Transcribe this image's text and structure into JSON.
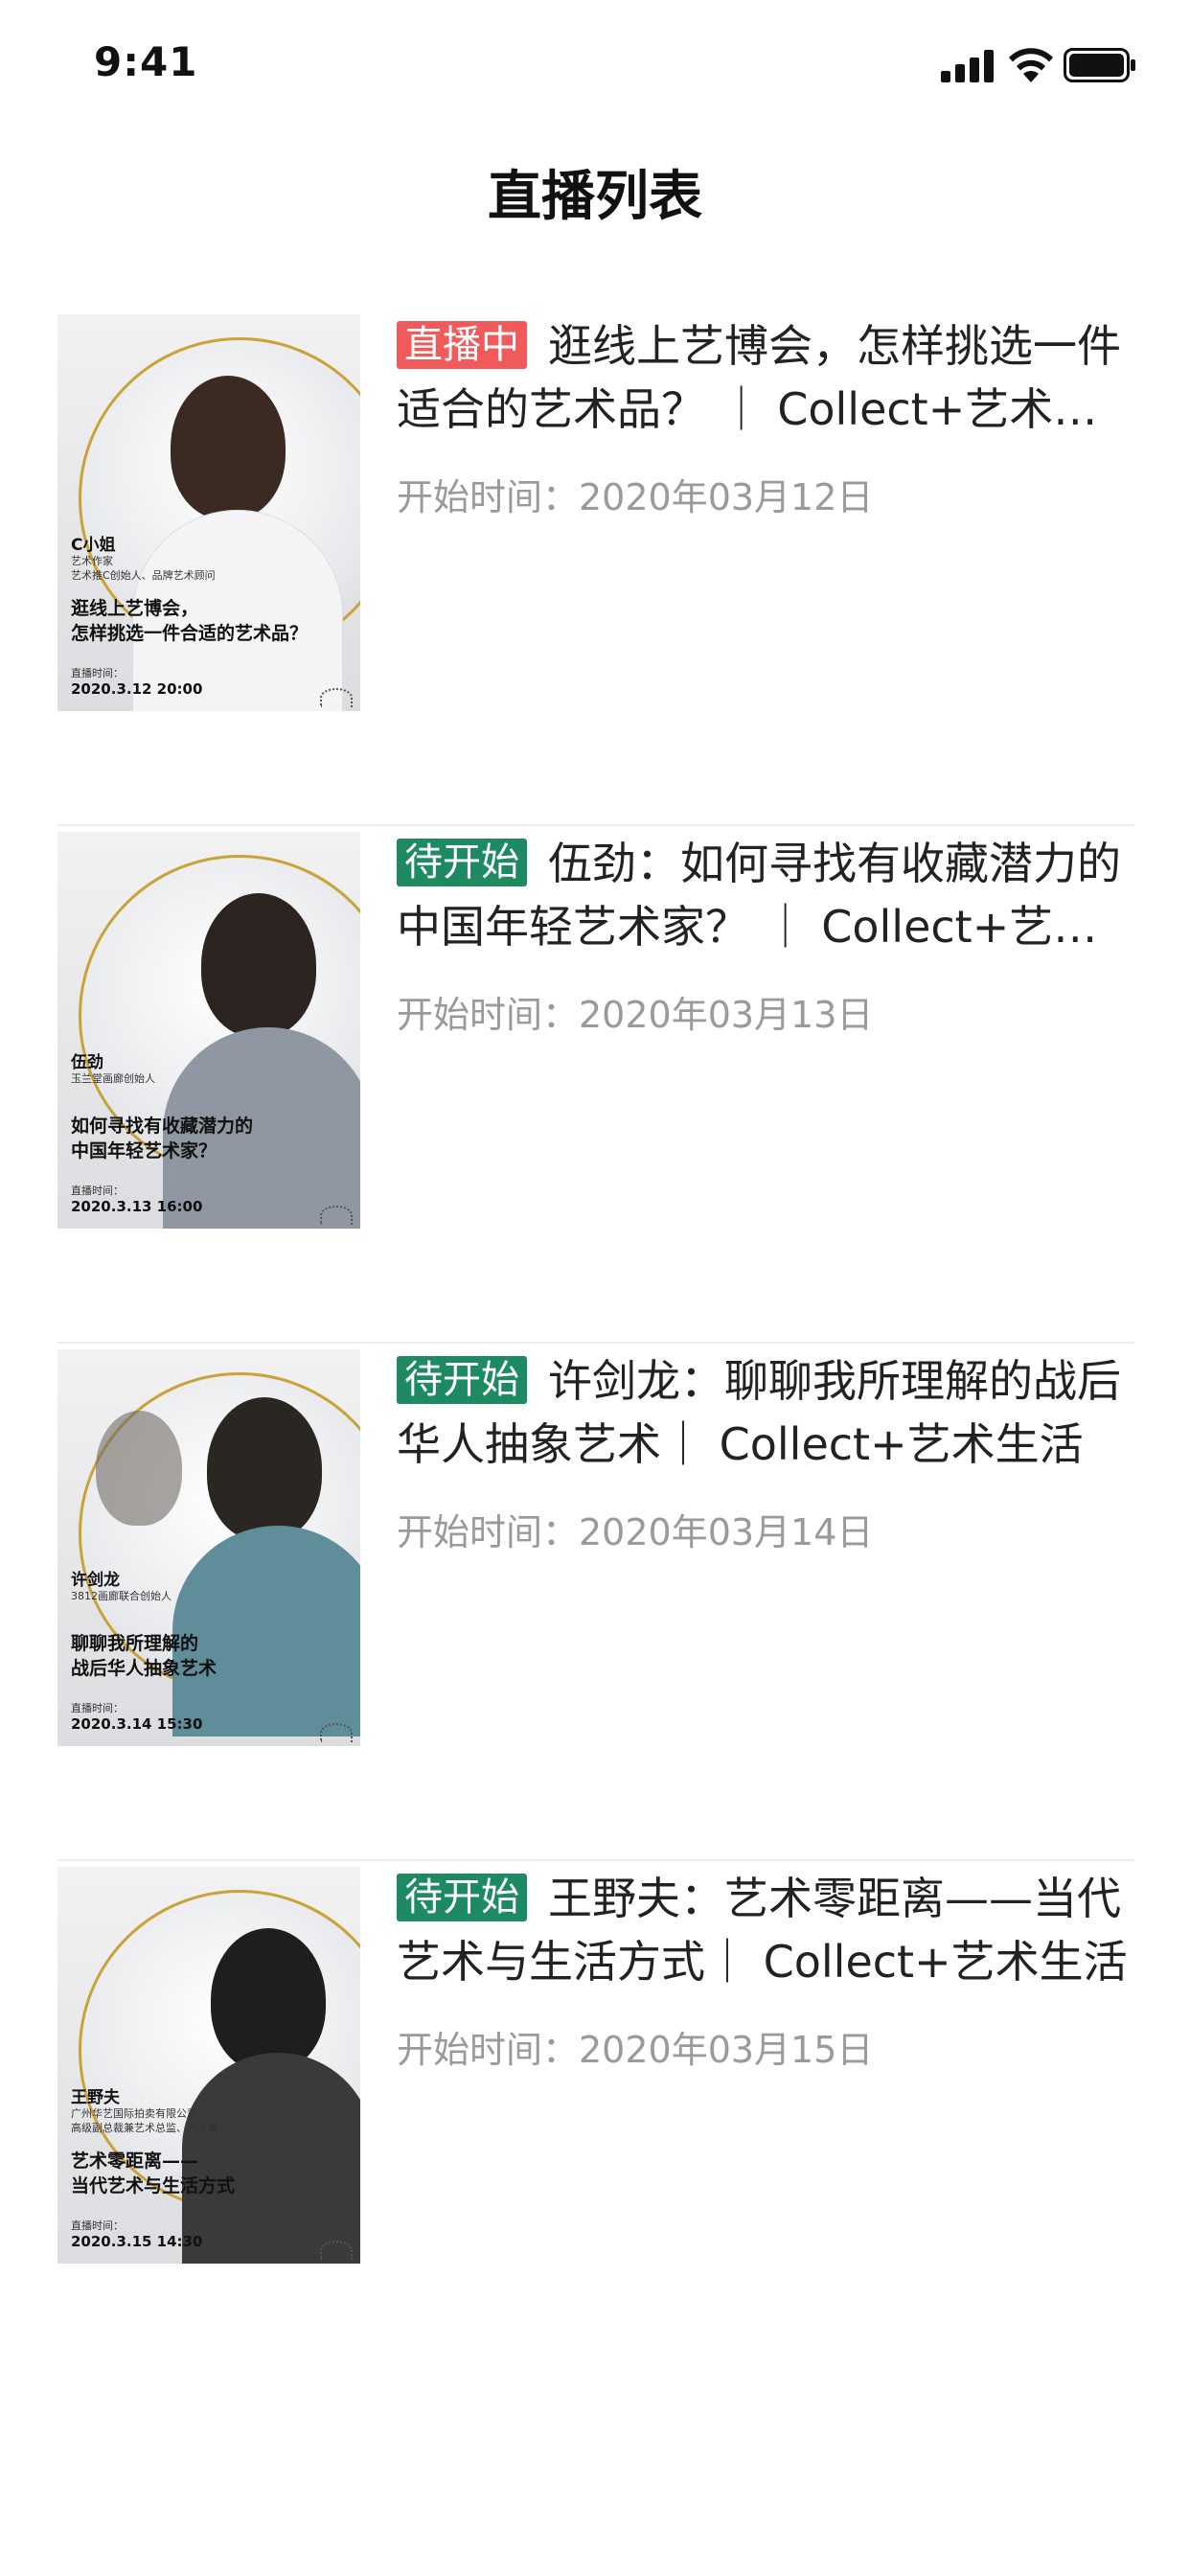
{
  "status_bar": {
    "time": "9:41"
  },
  "nav": {
    "title": "直播列表"
  },
  "colors": {
    "live_badge": "#f05a5a",
    "upcoming_badge": "#1e8a62",
    "gold_ring": "#c9a338",
    "meta_text": "#9a9a9a"
  },
  "items": [
    {
      "badge": "直播中",
      "badge_type": "live",
      "title": "逛线上艺博会，怎样挑选一件适合的艺术品？ ｜ Collect+艺术生活",
      "start_time": "开始时间：2020年03月12日",
      "poster": {
        "name": "C小姐",
        "subtitle": "艺术作家\n艺术推C创始人、品牌艺术顾问",
        "headline": "逛线上艺博会，\n怎样挑选一件合适的艺术品？",
        "time_label": "直播时间：",
        "time": "2020.3.12 20:00"
      }
    },
    {
      "badge": "待开始",
      "badge_type": "upcoming",
      "title": "伍劲：如何寻找有收藏潜力的中国年轻艺术家？ ｜ Collect+艺术生活",
      "start_time": "开始时间：2020年03月13日",
      "poster": {
        "name": "伍劲",
        "subtitle": "玉兰堂画廊创始人",
        "headline": "如何寻找有收藏潜力的\n中国年轻艺术家？",
        "time_label": "直播时间：",
        "time": "2020.3.13  16:00"
      }
    },
    {
      "badge": "待开始",
      "badge_type": "upcoming",
      "title": "许剑龙：聊聊我所理解的战后华人抽象艺术｜ Collect+艺术生活",
      "start_time": "开始时间：2020年03月14日",
      "poster": {
        "name": "许剑龙",
        "subtitle": "3812画廊联合创始人",
        "headline": "聊聊我所理解的\n战后华人抽象艺术",
        "time_label": "直播时间：",
        "time": "2020.3.14  15:30"
      }
    },
    {
      "badge": "待开始",
      "badge_type": "upcoming",
      "title": "王野夫：艺术零距离——当代艺术与生活方式｜ Collect+艺术生活",
      "start_time": "开始时间：2020年03月15日",
      "poster": {
        "name": "王野夫",
        "subtitle": "广州华艺国际拍卖有限公司\n高级副总裁兼艺术总监、艺术家",
        "headline": "艺术零距离——\n当代艺术与生活方式",
        "time_label": "直播时间：",
        "time": "2020.3.15  14:30"
      }
    }
  ]
}
